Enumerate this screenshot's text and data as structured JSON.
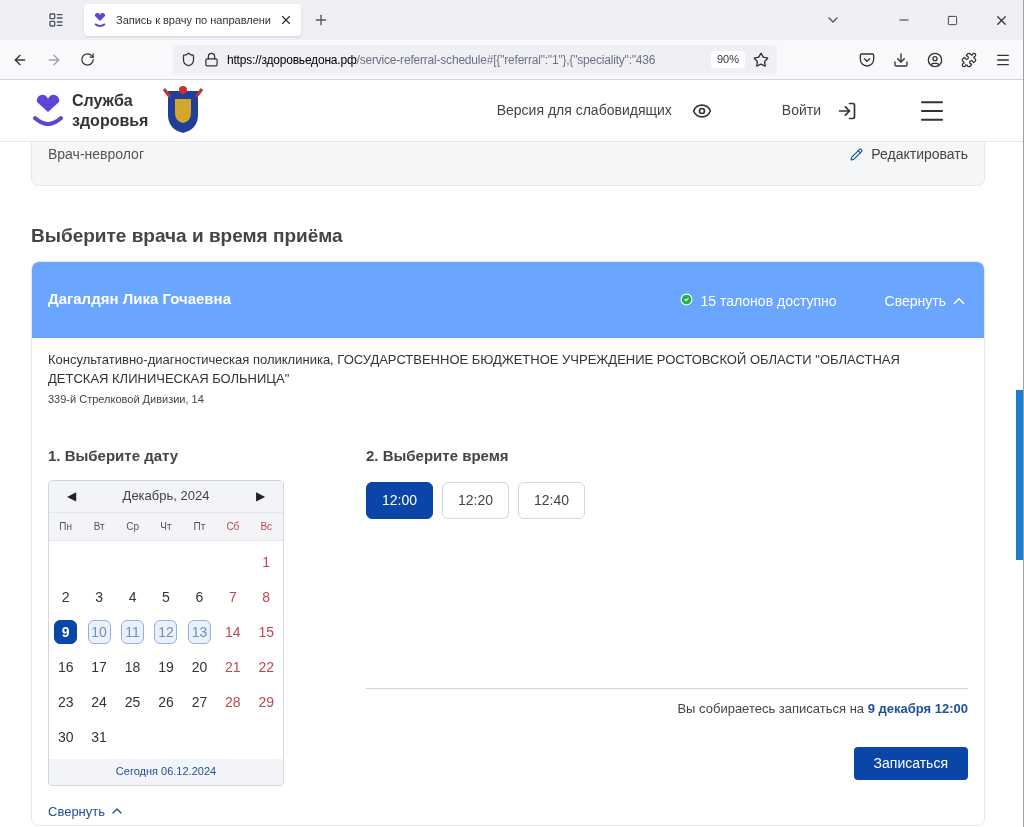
{
  "browser": {
    "tab_title": "Запись к врачу по направлени",
    "url_host": "https://здоровьедона.рф",
    "url_path": "/service-referral-schedule#[{\"referral\":\"1\"},{\"speciality\":\"436",
    "zoom": "90%"
  },
  "header": {
    "logo_line1": "Служба",
    "logo_line2": "здоровья",
    "accessibility": "Версия для слабовидящих",
    "login": "Войти"
  },
  "referral_card": {
    "speciality": "Врач-невролог",
    "edit": "Редактировать"
  },
  "section_title": "Выберите врача и время приёма",
  "doctor": {
    "name": "Дагалдян Лика Гочаевна",
    "tickets": "15 талонов доступно",
    "collapse": "Свернуть",
    "expanded": true,
    "clinic": "Консультативно-диагностическая поликлиника, ГОСУДАРСТВЕННОЕ БЮДЖЕТНОЕ УЧРЕЖДЕНИЕ РОСТОВСКОЙ ОБЛАСТИ \"ОБЛАСТНАЯ ДЕТСКАЯ КЛИНИЧЕСКАЯ БОЛЬНИЦА\"",
    "address": "339-й Стрелковой Дивизии, 14"
  },
  "date_step": {
    "title": "1. Выберите дату",
    "month": "Декабрь, 2024",
    "prev": "◀",
    "next": "▶",
    "today": "Сегодня 06.12.2024",
    "weekdays": [
      {
        "label": "Пн",
        "weekend": false
      },
      {
        "label": "Вт",
        "weekend": false
      },
      {
        "label": "Ср",
        "weekend": false
      },
      {
        "label": "Чт",
        "weekend": false
      },
      {
        "label": "Пт",
        "weekend": false
      },
      {
        "label": "Сб",
        "weekend": true
      },
      {
        "label": "Вс",
        "weekend": true
      }
    ],
    "weeks": [
      [
        {
          "kind": "blank"
        },
        {
          "kind": "blank"
        },
        {
          "kind": "blank"
        },
        {
          "kind": "blank"
        },
        {
          "kind": "blank"
        },
        {
          "kind": "blank"
        },
        {
          "kind": "day",
          "text": "1",
          "weekend": true,
          "available": false,
          "selected": false
        }
      ],
      [
        {
          "kind": "day",
          "text": "2",
          "weekend": false,
          "available": false,
          "selected": false
        },
        {
          "kind": "day",
          "text": "3",
          "weekend": false,
          "available": false,
          "selected": false
        },
        {
          "kind": "day",
          "text": "4",
          "weekend": false,
          "available": false,
          "selected": false
        },
        {
          "kind": "day",
          "text": "5",
          "weekend": false,
          "available": false,
          "selected": false
        },
        {
          "kind": "day",
          "text": "6",
          "weekend": false,
          "available": false,
          "selected": false
        },
        {
          "kind": "day",
          "text": "7",
          "weekend": true,
          "available": false,
          "selected": false
        },
        {
          "kind": "day",
          "text": "8",
          "weekend": true,
          "available": false,
          "selected": false
        }
      ],
      [
        {
          "kind": "day",
          "text": "9",
          "weekend": false,
          "available": true,
          "selected": true
        },
        {
          "kind": "day",
          "text": "10",
          "weekend": false,
          "available": true,
          "selected": false
        },
        {
          "kind": "day",
          "text": "11",
          "weekend": false,
          "available": true,
          "selected": false
        },
        {
          "kind": "day",
          "text": "12",
          "weekend": false,
          "available": true,
          "selected": false
        },
        {
          "kind": "day",
          "text": "13",
          "weekend": false,
          "available": true,
          "selected": false
        },
        {
          "kind": "day",
          "text": "14",
          "weekend": true,
          "available": false,
          "selected": false
        },
        {
          "kind": "day",
          "text": "15",
          "weekend": true,
          "available": false,
          "selected": false
        }
      ],
      [
        {
          "kind": "day",
          "text": "16",
          "weekend": false,
          "available": false,
          "selected": false
        },
        {
          "kind": "day",
          "text": "17",
          "weekend": false,
          "available": false,
          "selected": false
        },
        {
          "kind": "day",
          "text": "18",
          "weekend": false,
          "available": false,
          "selected": false
        },
        {
          "kind": "day",
          "text": "19",
          "weekend": false,
          "available": false,
          "selected": false
        },
        {
          "kind": "day",
          "text": "20",
          "weekend": false,
          "available": false,
          "selected": false
        },
        {
          "kind": "day",
          "text": "21",
          "weekend": true,
          "available": false,
          "selected": false
        },
        {
          "kind": "day",
          "text": "22",
          "weekend": true,
          "available": false,
          "selected": false
        }
      ],
      [
        {
          "kind": "day",
          "text": "23",
          "weekend": false,
          "available": false,
          "selected": false
        },
        {
          "kind": "day",
          "text": "24",
          "weekend": false,
          "available": false,
          "selected": false
        },
        {
          "kind": "day",
          "text": "25",
          "weekend": false,
          "available": false,
          "selected": false
        },
        {
          "kind": "day",
          "text": "26",
          "weekend": false,
          "available": false,
          "selected": false
        },
        {
          "kind": "day",
          "text": "27",
          "weekend": false,
          "available": false,
          "selected": false
        },
        {
          "kind": "day",
          "text": "28",
          "weekend": true,
          "available": false,
          "selected": false
        },
        {
          "kind": "day",
          "text": "29",
          "weekend": true,
          "available": false,
          "selected": false
        }
      ],
      [
        {
          "kind": "day",
          "text": "30",
          "weekend": false,
          "available": false,
          "selected": false
        },
        {
          "kind": "day",
          "text": "31",
          "weekend": false,
          "available": false,
          "selected": false
        },
        {
          "kind": "blank"
        },
        {
          "kind": "blank"
        },
        {
          "kind": "blank"
        },
        {
          "kind": "blank"
        },
        {
          "kind": "blank"
        }
      ]
    ]
  },
  "time_step": {
    "title": "2. Выберите время",
    "slots": [
      {
        "label": "12:00",
        "selected": true
      },
      {
        "label": "12:20",
        "selected": false
      },
      {
        "label": "12:40",
        "selected": false
      }
    ],
    "summary": "Вы собираетесь записаться на **9 декабря 12:00**",
    "submit": "Записаться"
  },
  "collapse_bottom": "Свернуть"
}
